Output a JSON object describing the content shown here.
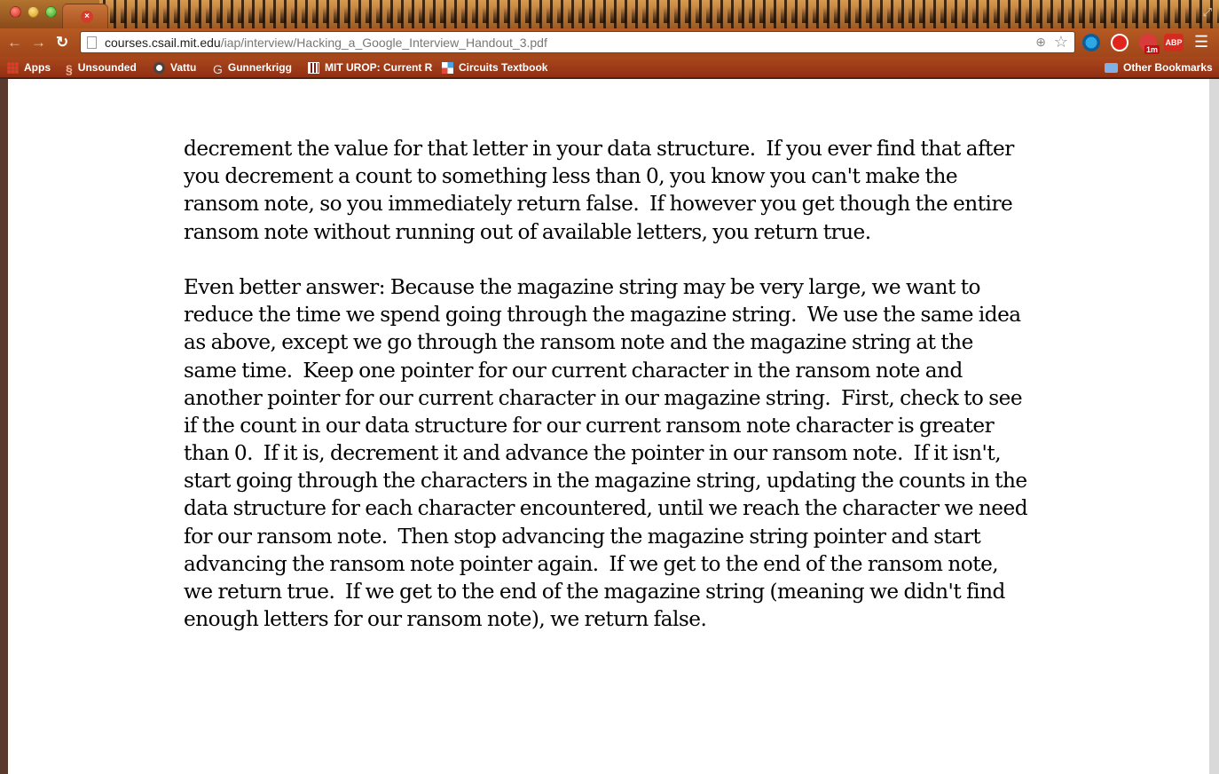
{
  "browser": {
    "tab": {
      "close_glyph": "×"
    },
    "nav": {
      "back": "←",
      "forward": "→",
      "reload": "C"
    },
    "url": {
      "host": "courses.csail.mit.edu",
      "path": "/iap/interview/Hacking_a_Google_Interview_Handout_3.pdf"
    },
    "extensions": {
      "badge_1m": "1m",
      "abp_label": "ABP"
    },
    "bookmarks": [
      {
        "label": "Apps",
        "icon": "apps-grid-icon"
      },
      {
        "label": "Unsounded",
        "icon": "unsounded-icon"
      },
      {
        "label": "Vattu",
        "icon": "vattu-icon"
      },
      {
        "label": "Gunnerkrigg",
        "icon": "gunnerkrigg-icon"
      },
      {
        "label": "MIT UROP: Current R",
        "icon": "mit-icon"
      },
      {
        "label": "Circuits Textbook",
        "icon": "circuits-icon"
      }
    ],
    "other_bookmarks": "Other Bookmarks"
  },
  "document": {
    "paragraph_1": [
      "decrement the value for that letter in your data structure.  If you ever find that after",
      "you decrement a count to something less than 0, you know you can't make the",
      "ransom note, so you immediately return false.  If however you get though the entire",
      "ransom note without running out of available letters, you return true."
    ],
    "paragraph_2": [
      "Even better answer: Because the magazine string may be very large, we want to",
      "reduce the time we spend going through the magazine string.  We use the same idea",
      "as above, except we go through the ransom note and the magazine string at the",
      "same time.  Keep one pointer for our current character in the ransom note and",
      "another pointer for our current character in our magazine string.  First, check to see",
      "if the count in our data structure for our current ransom note character is greater",
      "than 0.  If it is, decrement it and advance the pointer in our ransom note.  If it isn't,",
      "start going through the characters in the magazine string, updating the counts in the",
      "data structure for each character encountered, until we reach the character we need",
      "for our ransom note.  Then stop advancing the magazine string pointer and start",
      "advancing the ransom note pointer again.  If we get to the end of the ransom note,",
      "we return true.  If we get to the end of the magazine string (meaning we didn't find",
      "enough letters for our ransom note), we return false."
    ]
  }
}
